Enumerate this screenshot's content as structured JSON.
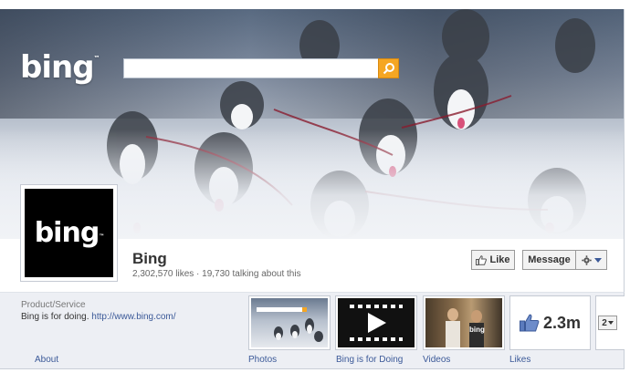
{
  "cover": {
    "logo_text": "bing",
    "logo_mark": "™",
    "search": {
      "value": "",
      "placeholder": "",
      "icon": "search-icon",
      "accent": "#f5a623"
    }
  },
  "profile": {
    "logo_text": "bing",
    "logo_mark": "™",
    "name": "Bing",
    "stats": "2,302,570 likes · 19,730 talking about this"
  },
  "actions": {
    "like_label": "Like",
    "message_label": "Message",
    "gear_icon": "gear-icon"
  },
  "info": {
    "category": "Product/Service",
    "about_text": "Bing is for doing.",
    "about_link": "http://www.bing.com/"
  },
  "apps": {
    "photos_label": "Photos",
    "bing_is_for_doing_label": "Bing is for Doing",
    "videos_label": "Videos",
    "likes_label": "Likes",
    "likes_count": "2.3m",
    "more_count": "2",
    "about_label": "About",
    "video_watermark": "bing"
  },
  "colors": {
    "link": "#3b5998",
    "cover_logo": "#ffffff",
    "profile_bg": "#000000",
    "search_btn": "#f5a623"
  }
}
